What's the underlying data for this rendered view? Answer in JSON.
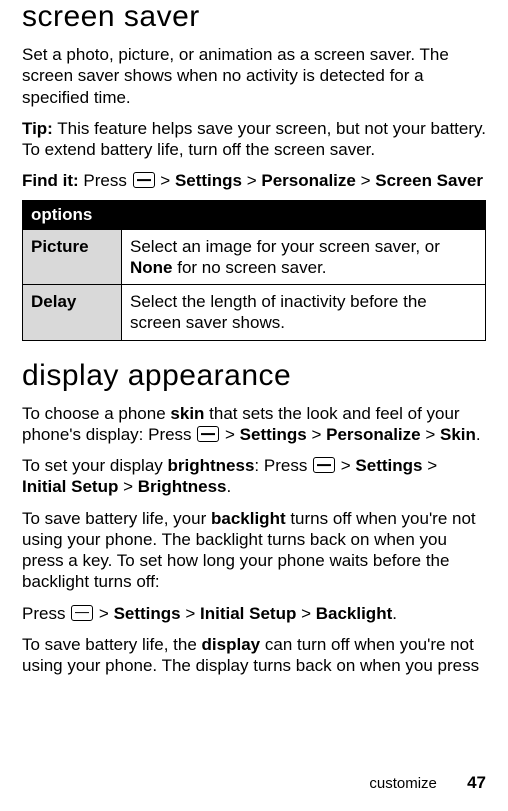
{
  "section1": {
    "heading": "screen saver",
    "para1": "Set a photo, picture, or animation as a screen saver. The screen saver shows when no activity is detected for a specified time.",
    "tip_label": "Tip:",
    "tip_text": " This feature helps save your screen, but not your battery. To extend battery life, turn off the screen saver.",
    "findit_label": "Find it:",
    "findit_press": " Press ",
    "path": {
      "sep": " > ",
      "a": "Settings",
      "b": "Personalize",
      "c": "Screen Saver"
    }
  },
  "table": {
    "header": "options",
    "rows": [
      {
        "label": "Picture",
        "pre": "Select an image for your screen saver, or ",
        "bold": "None",
        "post": " for no screen saver."
      },
      {
        "label": "Delay",
        "pre": "Select the length of inactivity before the screen saver shows.",
        "bold": "",
        "post": ""
      }
    ]
  },
  "section2": {
    "heading": "display appearance",
    "p1_a": "To choose a phone ",
    "p1_skin": "skin",
    "p1_b": " that sets the look and feel of your phone's display: Press ",
    "p1_path": {
      "sep": " > ",
      "a": "Settings",
      "b": "Personalize",
      "c": "Skin",
      "end": "."
    },
    "p2_a": "To set your display ",
    "p2_bold": "brightness",
    "p2_b": ": Press ",
    "p2_path": {
      "sep": " > ",
      "a": "Settings",
      "b": "Initial Setup",
      "c": "Brightness",
      "end": "."
    },
    "p3": "To save battery life, your ",
    "p3_bold": "backlight",
    "p3_b": " turns off when you're not using your phone. The backlight turns back on when you press a key. To set how long your phone waits before the backlight turns off:",
    "p4_a": "Press ",
    "p4_path": {
      "sep": " > ",
      "a": "Settings",
      "b": "Initial Setup",
      "c": "Backlight",
      "end": "."
    },
    "p5_a": "To save battery life, the ",
    "p5_bold": "display",
    "p5_b": " can turn off when you're not using your phone. The display turns back on when you press"
  },
  "footer": {
    "section": "customize",
    "page": "47"
  }
}
